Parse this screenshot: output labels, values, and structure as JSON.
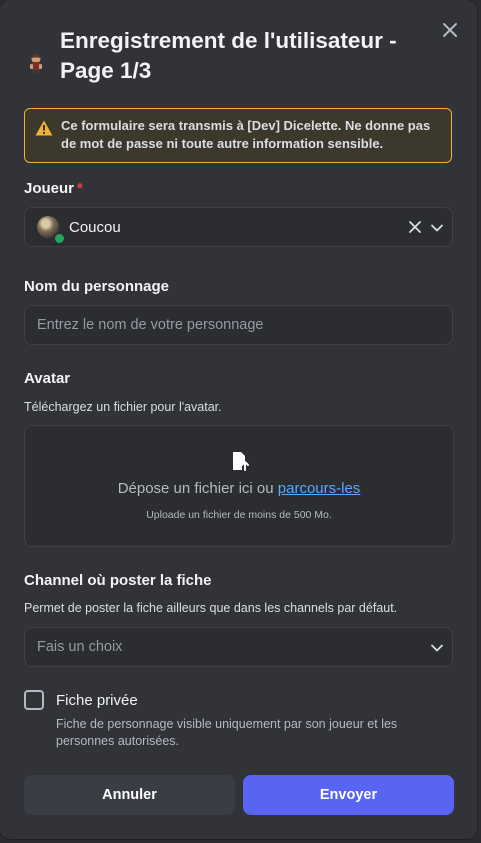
{
  "modal": {
    "title": "Enregistrement de l'utilisateur - Page 1/3",
    "warning": "Ce formulaire sera transmis à [Dev] Dicelette. Ne donne pas de mot de passe ni toute autre information sensible."
  },
  "player": {
    "label": "Joueur",
    "required_mark": "*",
    "selected": "Coucou"
  },
  "character": {
    "label": "Nom du personnage",
    "placeholder": "Entrez le nom de votre personnage"
  },
  "avatar": {
    "label": "Avatar",
    "description": "Téléchargez un fichier pour l'avatar.",
    "drop_text": "Dépose un fichier ici ou ",
    "browse_link": "parcours-les",
    "hint": "Uploade un fichier de moins de 500 Mo."
  },
  "channel": {
    "label": "Channel où poster la fiche",
    "description": "Permet de poster la fiche ailleurs que dans les channels par défaut.",
    "placeholder": "Fais un choix"
  },
  "private_sheet": {
    "label": "Fiche privée",
    "description": "Fiche de personnage visible uniquement par son joueur et les personnes autorisées.",
    "checked": false
  },
  "actions": {
    "cancel": "Annuler",
    "submit": "Envoyer"
  },
  "colors": {
    "accent": "#5865f2",
    "warning": "#f0b232",
    "required": "#f23f43",
    "online": "#23a55a",
    "link": "#5aa8ff"
  },
  "icons": {
    "close": "close-icon",
    "app": "bot-avatar-icon",
    "warning": "warning-triangle-icon",
    "clear": "clear-icon",
    "chevron": "chevron-down-icon",
    "upload": "file-upload-icon"
  }
}
